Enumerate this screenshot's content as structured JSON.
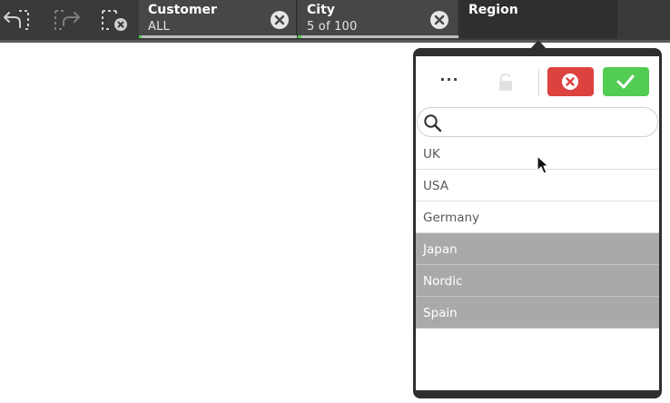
{
  "toolbar": {
    "step_back_icon": "step-back-icon",
    "step_forward_icon": "step-forward-icon",
    "clear_all_icon": "clear-all-selections-icon"
  },
  "selections": [
    {
      "field": "Customer",
      "value": "ALL"
    },
    {
      "field": "City",
      "value": "5 of 100"
    },
    {
      "field": "Region"
    }
  ],
  "popup": {
    "more_label": "···",
    "list": [
      {
        "label": "UK",
        "state": "possible"
      },
      {
        "label": "USA",
        "state": "possible"
      },
      {
        "label": "Germany",
        "state": "possible"
      },
      {
        "label": "Japan",
        "state": "excluded"
      },
      {
        "label": "Nordic",
        "state": "excluded"
      },
      {
        "label": "Spain",
        "state": "excluded"
      }
    ]
  },
  "colors": {
    "bar": "#3a3a3a",
    "confirm": "#52cc52",
    "cancel": "#dc423e",
    "excluded": "#a9a9a9"
  }
}
